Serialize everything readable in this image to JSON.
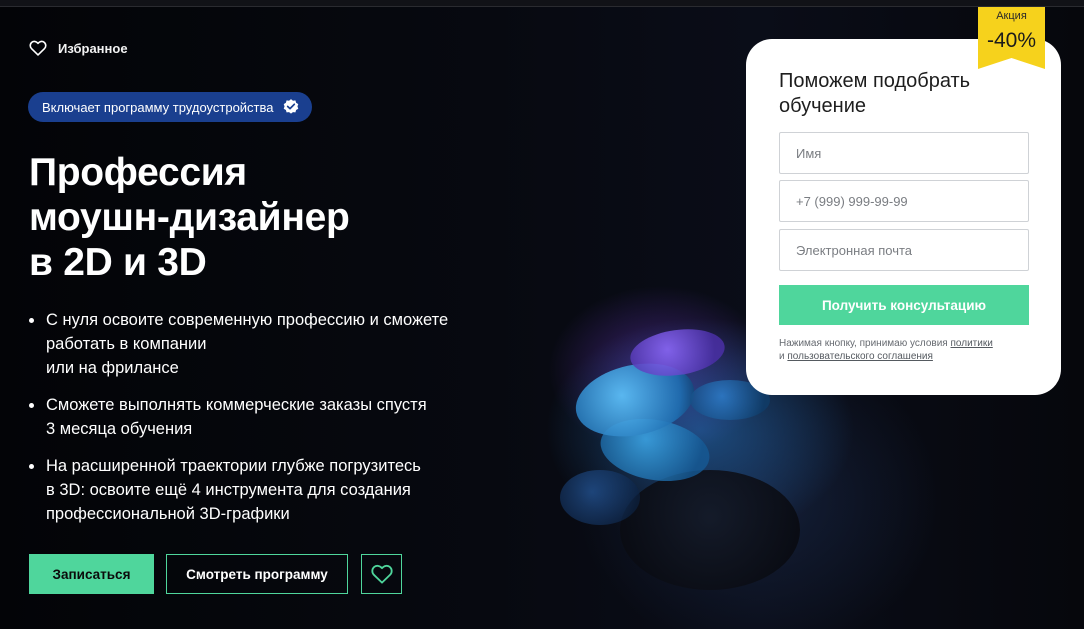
{
  "header": {
    "favorites_label": "Избранное"
  },
  "badge": {
    "label": "Включает программу трудоустройства"
  },
  "hero": {
    "title_lines": [
      "Профессия",
      "моушн-дизайнер",
      "в 2D и 3D"
    ],
    "bullets": [
      [
        "С нуля освоите современную профессию и сможете",
        "работать в компании",
        "или на фрилансе"
      ],
      [
        "Сможете выполнять коммерческие заказы спустя",
        "3 месяца обучения"
      ],
      [
        "На расширенной траектории глубже погрузитесь",
        "в 3D: освоите ещё 4 инструмента для создания",
        "профессиональной 3D-графики"
      ]
    ]
  },
  "actions": {
    "enroll_label": "Записаться",
    "view_program_label": "Смотреть программу"
  },
  "form": {
    "title": "Поможем подобрать обучение",
    "name_placeholder": "Имя",
    "phone_placeholder": "+7 (999) 999-99-99",
    "email_placeholder": "Электронная почта",
    "submit_label": "Получить консультацию",
    "legal_prefix": "Нажимая кнопку, принимаю условия ",
    "legal_link_policy": "политики",
    "legal_middle": "и ",
    "legal_link_agreement": "пользовательского соглашения"
  },
  "promo": {
    "label": "Акция",
    "discount": "-40%"
  },
  "colors": {
    "accent_green": "#4fd69c",
    "badge_blue": "#1a3f8f",
    "promo_yellow": "#f6d21c"
  },
  "icons": [
    "heart-icon",
    "verified-check-icon"
  ]
}
